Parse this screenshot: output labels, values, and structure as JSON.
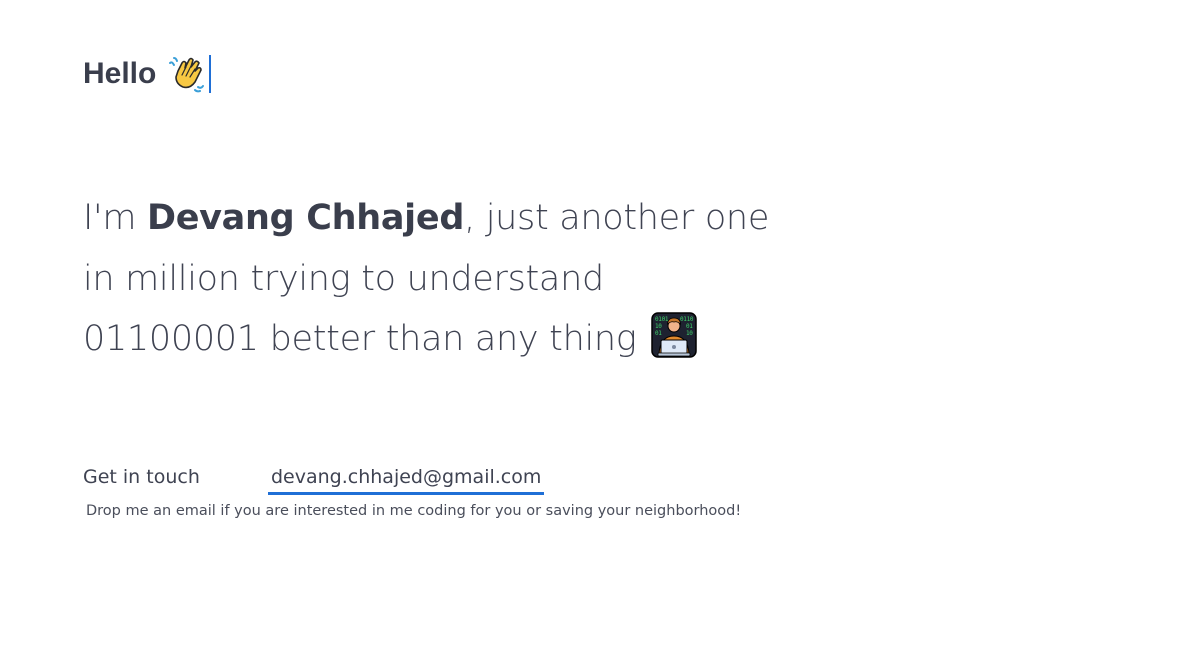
{
  "greeting": {
    "text": "Hello",
    "emoji_icon": "waving-hand-icon"
  },
  "intro": {
    "prefix": "I'm ",
    "name": "Devang Chhajed",
    "line1_suffix": ", just another one",
    "line2": "in million trying to understand",
    "line3": "01100001 better than any thing",
    "emoji_icon": "technologist-icon"
  },
  "contact": {
    "label": "Get in touch",
    "email": "devang.chhajed@gmail.com",
    "note": "Drop me an email if you are interested in me coding for you or saving your neighborhood!"
  },
  "colors": {
    "text": "#3f4352",
    "accent": "#1f6fd6",
    "background": "#ffffff"
  }
}
